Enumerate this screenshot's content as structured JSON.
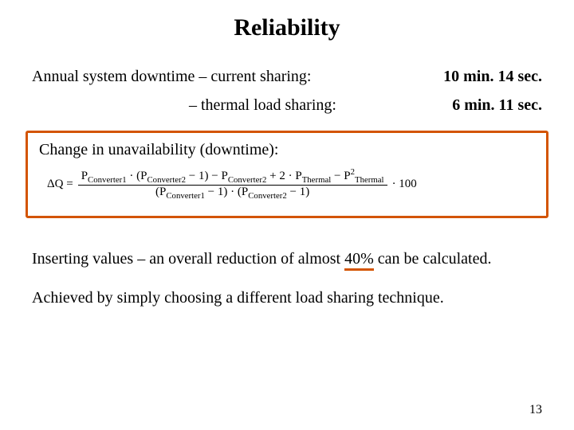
{
  "title": "Reliability",
  "rows": [
    {
      "label": "Annual system downtime – current sharing:",
      "value": "10 min. 14 sec."
    },
    {
      "label": "– thermal load sharing:",
      "value": "6 min. 11 sec."
    }
  ],
  "callout": {
    "heading": "Change in unavailability (downtime):",
    "eq_lhs": "ΔQ =",
    "eq_num": "P_Converter1 · (P_Converter2 − 1) − P_Converter2 + 2 · P_Thermal − P²_Thermal",
    "eq_den": "(P_Converter1 − 1) · (P_Converter2 − 1)",
    "eq_tail": "· 100"
  },
  "para1_a": "Inserting values – an overall reduction of almost ",
  "para1_hl": "40%",
  "para1_b": " can be calculated.",
  "para2": "Achieved by simply choosing a different load sharing technique.",
  "page": "13"
}
